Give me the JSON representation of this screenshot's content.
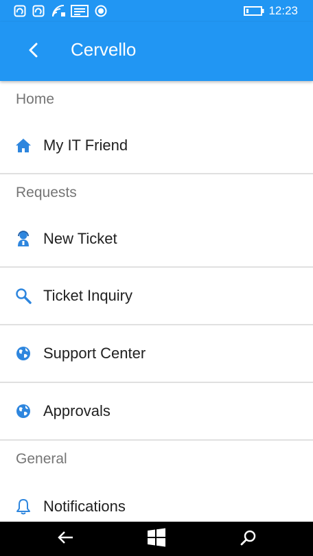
{
  "status_bar": {
    "time": "12:23",
    "icons": [
      "sync-icon",
      "sync-icon",
      "wifi-icon",
      "message-icon",
      "record-icon",
      "battery-icon"
    ]
  },
  "header": {
    "title": "Cervello",
    "back_icon": "chevron-left-icon"
  },
  "menu": {
    "sections": [
      {
        "header": "Home",
        "items": [
          {
            "label": "My IT Friend",
            "icon": "home-icon"
          }
        ]
      },
      {
        "header": "Requests",
        "items": [
          {
            "label": "New Ticket",
            "icon": "agent-icon"
          },
          {
            "label": "Ticket Inquiry",
            "icon": "search-icon"
          },
          {
            "label": "Support Center",
            "icon": "globe-icon"
          },
          {
            "label": "Approvals",
            "icon": "globe-icon"
          }
        ]
      },
      {
        "header": "General",
        "items": [
          {
            "label": "Notifications",
            "icon": "bell-icon"
          }
        ]
      }
    ]
  },
  "nav_bar": {
    "icons": [
      "back-arrow-icon",
      "windows-icon",
      "search-icon"
    ]
  },
  "colors": {
    "accent": "#2196f3",
    "icon_blue": "#2e86de",
    "header_text": "#757575",
    "item_text": "#212121",
    "divider": "#e0e0e0"
  }
}
